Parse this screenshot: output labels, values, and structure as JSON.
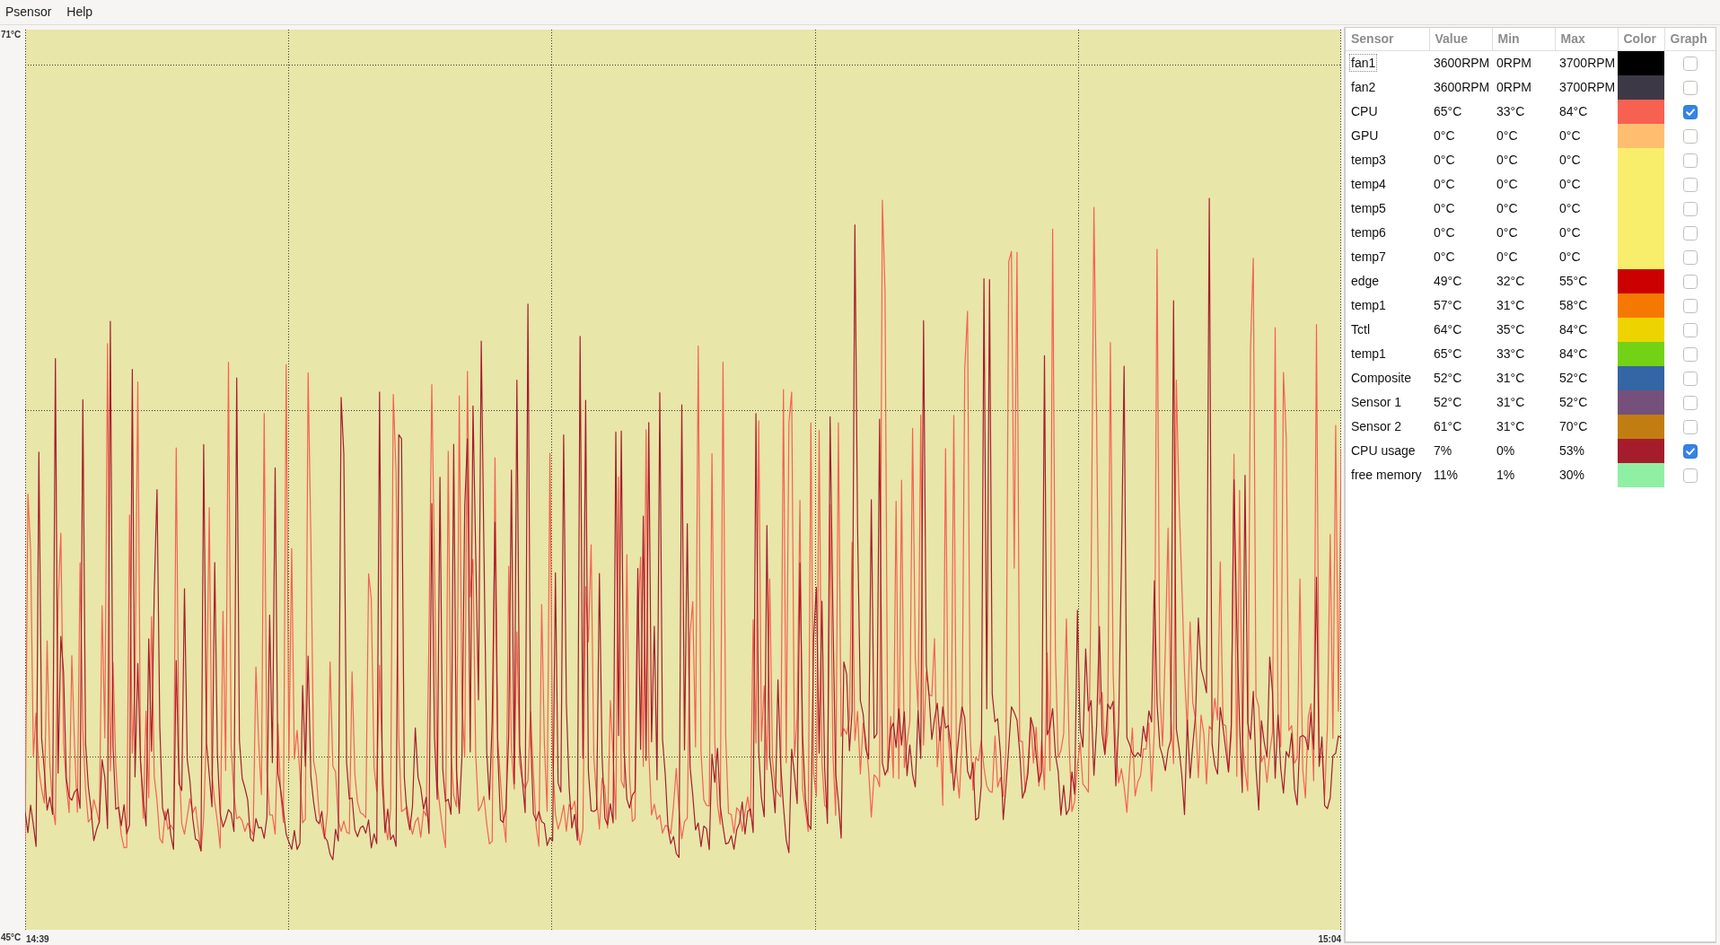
{
  "menu": [
    {
      "label": "Psensor"
    },
    {
      "label": "Help"
    }
  ],
  "graph": {
    "y_max_label": "71°C",
    "y_min_label": "45°C",
    "time_start": "14:39",
    "time_end": "15:04"
  },
  "table": {
    "columns": [
      "Sensor",
      "Value",
      "Min",
      "Max",
      "Color",
      "Graph"
    ],
    "rows": [
      {
        "name": "fan1",
        "value": "3600RPM",
        "min": "0RPM",
        "max": "3700RPM",
        "color": "#000000",
        "graph": false,
        "focused": true
      },
      {
        "name": "fan2",
        "value": "3600RPM",
        "min": "0RPM",
        "max": "3700RPM",
        "color": "#3d3846",
        "graph": false,
        "focused": false
      },
      {
        "name": "CPU",
        "value": "65°C",
        "min": "33°C",
        "max": "84°C",
        "color": "#f66151",
        "graph": true,
        "focused": false
      },
      {
        "name": "GPU",
        "value": "0°C",
        "min": "0°C",
        "max": "0°C",
        "color": "#ffbe6f",
        "graph": false,
        "focused": false
      },
      {
        "name": "temp3",
        "value": "0°C",
        "min": "0°C",
        "max": "0°C",
        "color": "#f8ee6c",
        "graph": false,
        "focused": false
      },
      {
        "name": "temp4",
        "value": "0°C",
        "min": "0°C",
        "max": "0°C",
        "color": "#f8ee6c",
        "graph": false,
        "focused": false
      },
      {
        "name": "temp5",
        "value": "0°C",
        "min": "0°C",
        "max": "0°C",
        "color": "#f8ee6c",
        "graph": false,
        "focused": false
      },
      {
        "name": "temp6",
        "value": "0°C",
        "min": "0°C",
        "max": "0°C",
        "color": "#f8ee6c",
        "graph": false,
        "focused": false
      },
      {
        "name": "temp7",
        "value": "0°C",
        "min": "0°C",
        "max": "0°C",
        "color": "#f8ee6c",
        "graph": false,
        "focused": false
      },
      {
        "name": "edge",
        "value": "49°C",
        "min": "32°C",
        "max": "55°C",
        "color": "#cc0000",
        "graph": false,
        "focused": false
      },
      {
        "name": "temp1",
        "value": "57°C",
        "min": "31°C",
        "max": "58°C",
        "color": "#f57900",
        "graph": false,
        "focused": false
      },
      {
        "name": "Tctl",
        "value": "64°C",
        "min": "35°C",
        "max": "84°C",
        "color": "#edd400",
        "graph": false,
        "focused": false
      },
      {
        "name": "temp1",
        "value": "65°C",
        "min": "33°C",
        "max": "84°C",
        "color": "#73d216",
        "graph": false,
        "focused": false
      },
      {
        "name": "Composite",
        "value": "52°C",
        "min": "31°C",
        "max": "52°C",
        "color": "#3465a4",
        "graph": false,
        "focused": false
      },
      {
        "name": "Sensor 1",
        "value": "52°C",
        "min": "31°C",
        "max": "52°C",
        "color": "#75507b",
        "graph": false,
        "focused": false
      },
      {
        "name": "Sensor 2",
        "value": "61°C",
        "min": "31°C",
        "max": "70°C",
        "color": "#c17d11",
        "graph": false,
        "focused": false
      },
      {
        "name": "CPU usage",
        "value": "7%",
        "min": "0%",
        "max": "53%",
        "color": "#a51d2d",
        "graph": true,
        "focused": false
      },
      {
        "name": "free memory",
        "value": "11%",
        "min": "1%",
        "max": "30%",
        "color": "#8ff0a4",
        "graph": false,
        "focused": false
      }
    ]
  }
}
